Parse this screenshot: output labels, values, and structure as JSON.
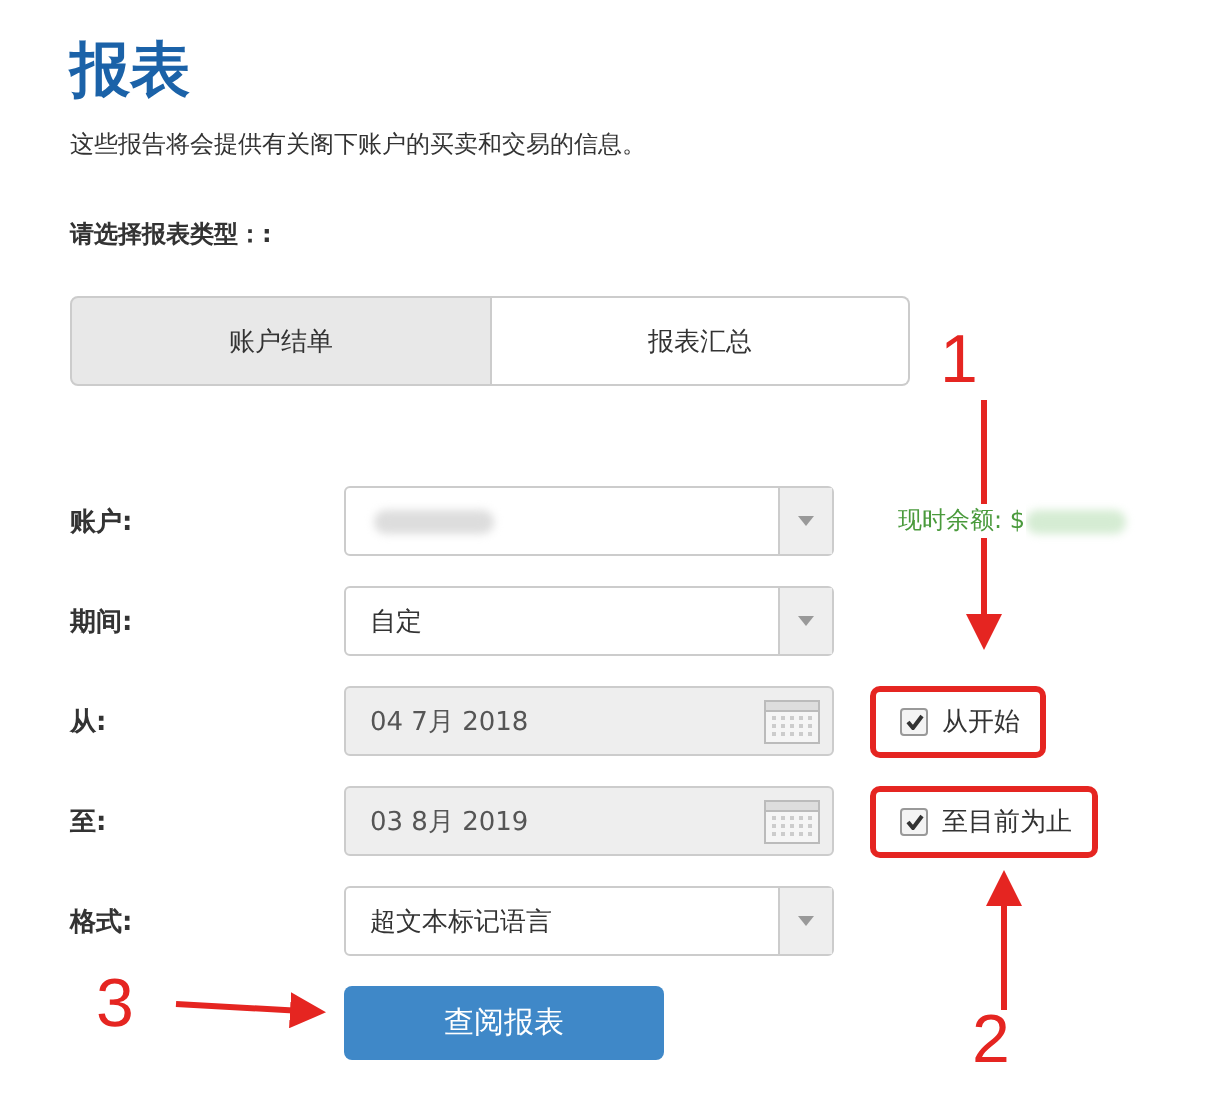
{
  "title": "报表",
  "subtitle": "这些报告将会提供有关阁下账户的买卖和交易的信息。",
  "report_type_label": "请选择报表类型：:",
  "tabs": [
    {
      "label": "账户结单",
      "selected": true
    },
    {
      "label": "报表汇总",
      "selected": false
    }
  ],
  "form": {
    "account": {
      "label": "账户:",
      "balance_label": "现时余额: $"
    },
    "period": {
      "label": "期间:",
      "value": "自定"
    },
    "from": {
      "label": "从:",
      "value": "04 7月 2018",
      "checkbox": {
        "label": "从开始",
        "checked": true,
        "highlighted": true
      }
    },
    "to": {
      "label": "至:",
      "value": "03 8月 2019",
      "checkbox": {
        "label": "至目前为止",
        "checked": true,
        "highlighted": true
      }
    },
    "format": {
      "label": "格式:",
      "value": "超文本标记语言"
    }
  },
  "submit_button": "查阅报表",
  "annotations": [
    "1",
    "2",
    "3"
  ]
}
